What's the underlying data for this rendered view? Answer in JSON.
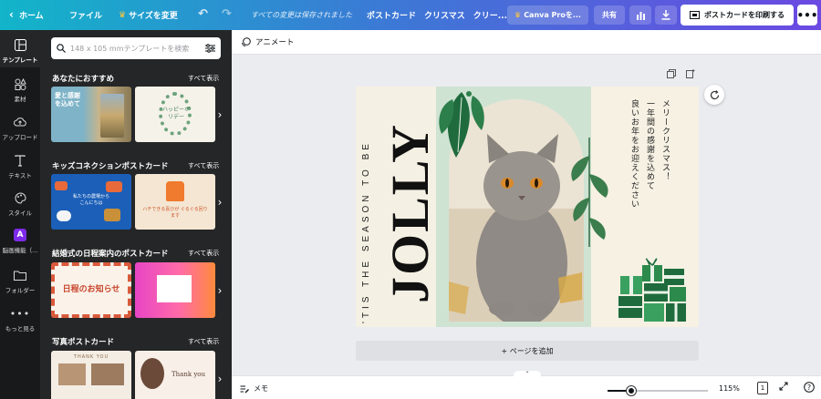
{
  "topbar": {
    "home": "ホーム",
    "file": "ファイル",
    "resize": "サイズを変更",
    "saved_status": "すべての変更は保存されました",
    "doc_title": "ポストカード　クリスマス　クリー...",
    "pro_button": "Canva Proを...",
    "share": "共有",
    "print_button": "ポストカードを印刷する"
  },
  "sidenav": {
    "items": [
      {
        "label": "テンプレート",
        "icon": "template-icon"
      },
      {
        "label": "素材",
        "icon": "elements-icon"
      },
      {
        "label": "アップロード",
        "icon": "upload-icon"
      },
      {
        "label": "テキスト",
        "icon": "text-icon"
      },
      {
        "label": "スタイル",
        "icon": "style-icon"
      },
      {
        "label": "脳画機能（...",
        "icon": "brand-icon"
      },
      {
        "label": "フォルダー",
        "icon": "folder-icon"
      },
      {
        "label": "もっと見る",
        "icon": "more-icon"
      }
    ]
  },
  "panel": {
    "search_placeholder": "148 x 105 mmテンプレートを検索",
    "see_all": "すべて表示",
    "sections": [
      {
        "title": "あなたにおすすめ",
        "thumb1_text": "愛と感謝を込めて",
        "thumb2_text": "ハッピーホリデー"
      },
      {
        "title": "キッズコネクションポストカード",
        "thumb1_text": "私たちの農場からこんにちは",
        "thumb2_text": "ハチできる喜びが ぐるぐる回ります"
      },
      {
        "title": "結婚式の日程案内のポストカード",
        "thumb1_text": "日程のお知らせ",
        "thumb2_text": ""
      },
      {
        "title": "写真ポストカード",
        "thumb1_text": "THANK YOU",
        "thumb2_text": "Thank you"
      }
    ]
  },
  "workspace": {
    "animate": "アニメート",
    "add_page": "+ ページを追加",
    "memo": "メモ",
    "zoom": "115%",
    "zoom_fraction": 0.24,
    "page_number": "1"
  },
  "card": {
    "tagline": "'TIS THE SEASON TO BE",
    "headline": "JOLLY",
    "message_columns": [
      "メリークリスマス！",
      "一年間の感謝を込めて",
      "良いお年をお迎えください"
    ]
  },
  "colors": {
    "accent": "#8b3dff",
    "card_bg": "#f4f0e3",
    "card_green": "#cfe3d3"
  }
}
